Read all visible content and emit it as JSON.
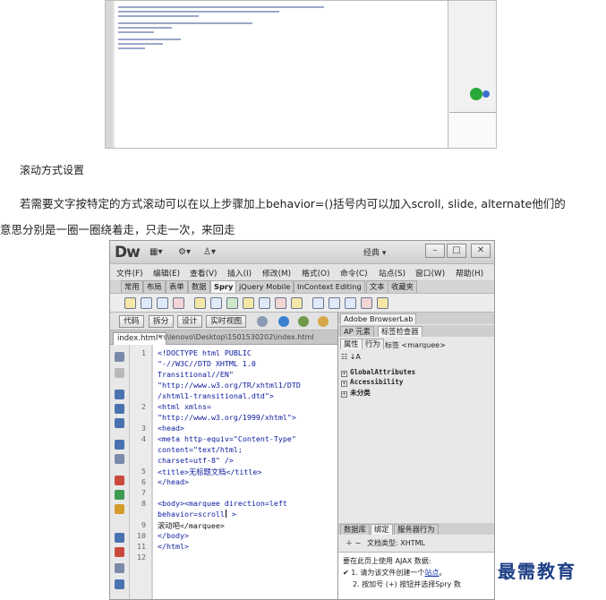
{
  "article": {
    "heading": "滚动方式设置",
    "para_line1": "若需要文字按特定的方式滚动可以在以上步骤加上behavior=()括号内可以加入scroll, slide, alternate他们的",
    "para_line2": "意思分别是一圈一圈绕着走，只走一次，来回走"
  },
  "dw": {
    "logo": "Dw",
    "layout": "经典 ▾",
    "window_buttons": [
      "–",
      "□",
      "✕"
    ],
    "menu": [
      "文件(F)",
      "编辑(E)",
      "查看(V)",
      "插入(I)",
      "修改(M)",
      "格式(O)",
      "命令(C)",
      "站点(S)",
      "窗口(W)",
      "帮助(H)"
    ],
    "insert_tabs": [
      "常用",
      "布局",
      "表单",
      "数据",
      "Spry",
      "jQuery Mobile",
      "InContext Editing",
      "文本",
      "收藏夹"
    ],
    "view_buttons": [
      "代码",
      "拆分",
      "设计",
      "实时视图"
    ],
    "file_tab": "index.html*",
    "file_path": "rs\\lenovo\\Desktop\\1501530202\\index.html",
    "line_numbers": [
      "1",
      "2",
      "3",
      "4",
      "5",
      "6",
      "7",
      "8",
      "9",
      "10",
      "11",
      "12"
    ],
    "code_lines": [
      "<!DOCTYPE html PUBLIC",
      "\"-//W3C//DTD XHTML 1.0",
      "Transitional//EN\"",
      "\"http://www.w3.org/TR/xhtml1/DTD",
      "/xhtml1-transitional.dtd\">",
      "<html xmlns=",
      "\"http://www.w3.org/1999/xhtml\">",
      "<head>",
      "<meta http-equiv=\"Content-Type\"",
      "content=\"text/html;",
      "charset=utf-8\" />",
      "<title>无标题文档</title>",
      "</head>",
      "",
      "<body><marquee direction=left",
      "behavior=scroll",
      " >",
      "滚动吧</marquee>",
      "</body>",
      "</html>"
    ],
    "panel": {
      "browserlab": "Adobe BrowserLab",
      "tab_ap": "AP 元素",
      "tab_tag": "标签检查器",
      "tab_attr": "属性",
      "tab_behavior": "行为",
      "tag_label": "标签 <marquee>",
      "tree": [
        "GlobalAttributes",
        "Accessibility",
        "未分类"
      ],
      "bottom_tabs": [
        "数据库",
        "绑定",
        "服务器行为"
      ],
      "doc_type": "文档类型: XHTML",
      "ajax_title": "要在此页上使用 AJAX 数据:",
      "ajax_step1_prefix": "1. 请为该文件创建一个",
      "ajax_step1_link": "站点",
      "ajax_step2": "2. 按加号 (+) 按钮并选择Spry 数"
    }
  },
  "watermark": "最需教育",
  "colors": {
    "code_blue": "#0a1a9e",
    "watermark": "#1d3f86"
  }
}
